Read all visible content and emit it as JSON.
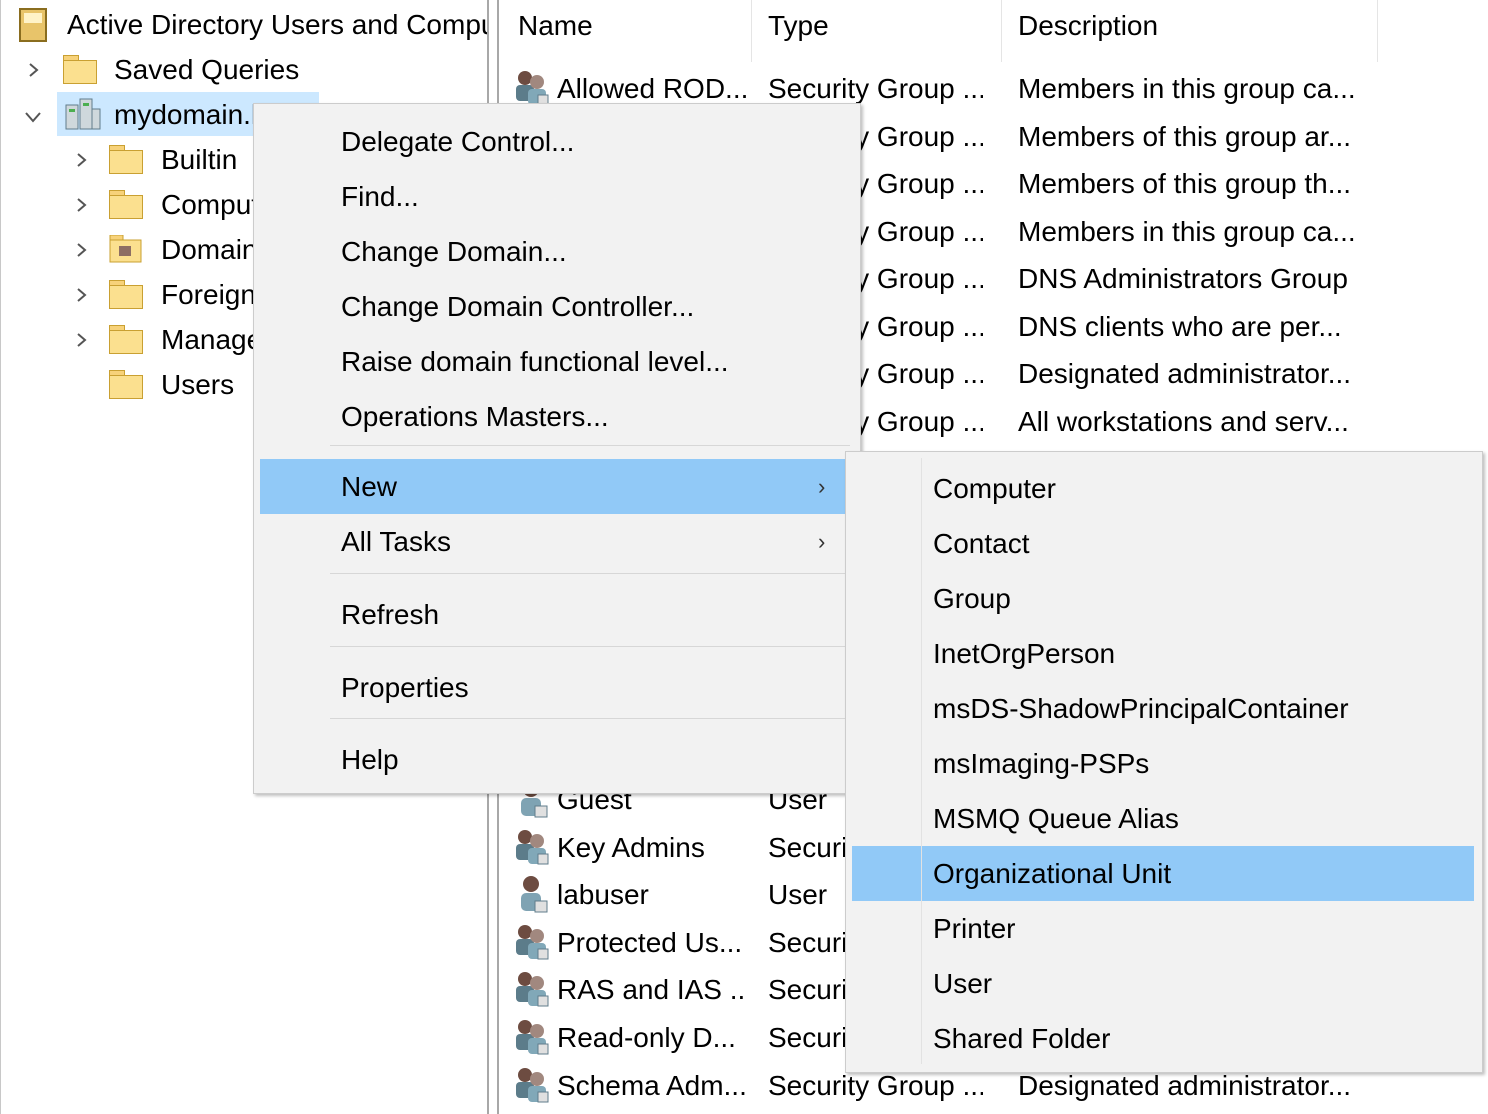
{
  "tree": {
    "root_label": "Active Directory Users and Computers",
    "items": [
      {
        "label": "Saved Queries",
        "icon": "folder-icon"
      },
      {
        "label": "mydomain.local",
        "icon": "domain-icon"
      },
      {
        "label": "Builtin",
        "icon": "folder-icon"
      },
      {
        "label": "Computers",
        "icon": "folder-icon"
      },
      {
        "label": "Domain Controllers",
        "icon": "ou-icon"
      },
      {
        "label": "ForeignSecurityPrincipals",
        "icon": "folder-icon"
      },
      {
        "label": "Managed Service Accounts",
        "icon": "folder-icon"
      },
      {
        "label": "Users",
        "icon": "folder-icon"
      }
    ]
  },
  "list": {
    "columns": [
      "Name",
      "Type",
      "Description"
    ],
    "rows": [
      {
        "name": "Allowed ROD...",
        "type": "Security Group ...",
        "description": "Members in this group ca...",
        "icon": "group-icon"
      },
      {
        "name": "",
        "type": "Security Group ...",
        "description": "Members of this group ar...",
        "icon": "group-icon"
      },
      {
        "name": "",
        "type": "Security Group ...",
        "description": "Members of this group th...",
        "icon": "group-icon"
      },
      {
        "name": "",
        "type": "Security Group ...",
        "description": "Members in this group ca...",
        "icon": "group-icon"
      },
      {
        "name": "",
        "type": "Security Group ...",
        "description": "DNS Administrators Group",
        "icon": "group-icon"
      },
      {
        "name": "",
        "type": "Security Group ...",
        "description": "DNS clients who are per...",
        "icon": "group-icon"
      },
      {
        "name": "",
        "type": "Security Group ...",
        "description": "Designated administrator...",
        "icon": "group-icon"
      },
      {
        "name": "",
        "type": "Security Group ...",
        "description": "All workstations and serv...",
        "icon": "group-icon"
      },
      {
        "name": "Guest",
        "type": "User",
        "description": "",
        "icon": "user-icon"
      },
      {
        "name": "Key Admins",
        "type": "Security Group ...",
        "description": "",
        "icon": "group-icon"
      },
      {
        "name": "labuser",
        "type": "User",
        "description": "",
        "icon": "user-icon"
      },
      {
        "name": "Protected Us...",
        "type": "Security Group ...",
        "description": "",
        "icon": "group-icon"
      },
      {
        "name": "RAS and IAS ...",
        "type": "Security Group ...",
        "description": "",
        "icon": "group-icon"
      },
      {
        "name": "Read-only D...",
        "type": "Security Group ...",
        "description": "",
        "icon": "group-icon"
      },
      {
        "name": "Schema Adm...",
        "type": "Security Group ...",
        "description": "Designated administrator...",
        "icon": "group-icon"
      }
    ]
  },
  "context_menu": {
    "items": [
      {
        "label": "Delegate Control..."
      },
      {
        "label": "Find..."
      },
      {
        "label": "Change Domain..."
      },
      {
        "label": "Change Domain Controller..."
      },
      {
        "label": "Raise domain functional level..."
      },
      {
        "label": "Operations Masters..."
      },
      {
        "label": "New",
        "submenu_arrow": "›",
        "highlighted": true
      },
      {
        "label": "All Tasks",
        "submenu_arrow": "›"
      },
      {
        "label": "Refresh"
      },
      {
        "label": "Properties"
      },
      {
        "label": "Help"
      }
    ]
  },
  "new_submenu": {
    "items": [
      {
        "label": "Computer"
      },
      {
        "label": "Contact"
      },
      {
        "label": "Group"
      },
      {
        "label": "InetOrgPerson"
      },
      {
        "label": "msDS-ShadowPrincipalContainer"
      },
      {
        "label": "msImaging-PSPs"
      },
      {
        "label": "MSMQ Queue Alias"
      },
      {
        "label": "Organizational Unit",
        "highlighted": true
      },
      {
        "label": "Printer"
      },
      {
        "label": "User"
      },
      {
        "label": "Shared Folder"
      }
    ]
  },
  "colors": {
    "highlight": "#91c9f7",
    "selected_tree_item": "#cce8ff",
    "menu_background": "#f2f2f2"
  }
}
